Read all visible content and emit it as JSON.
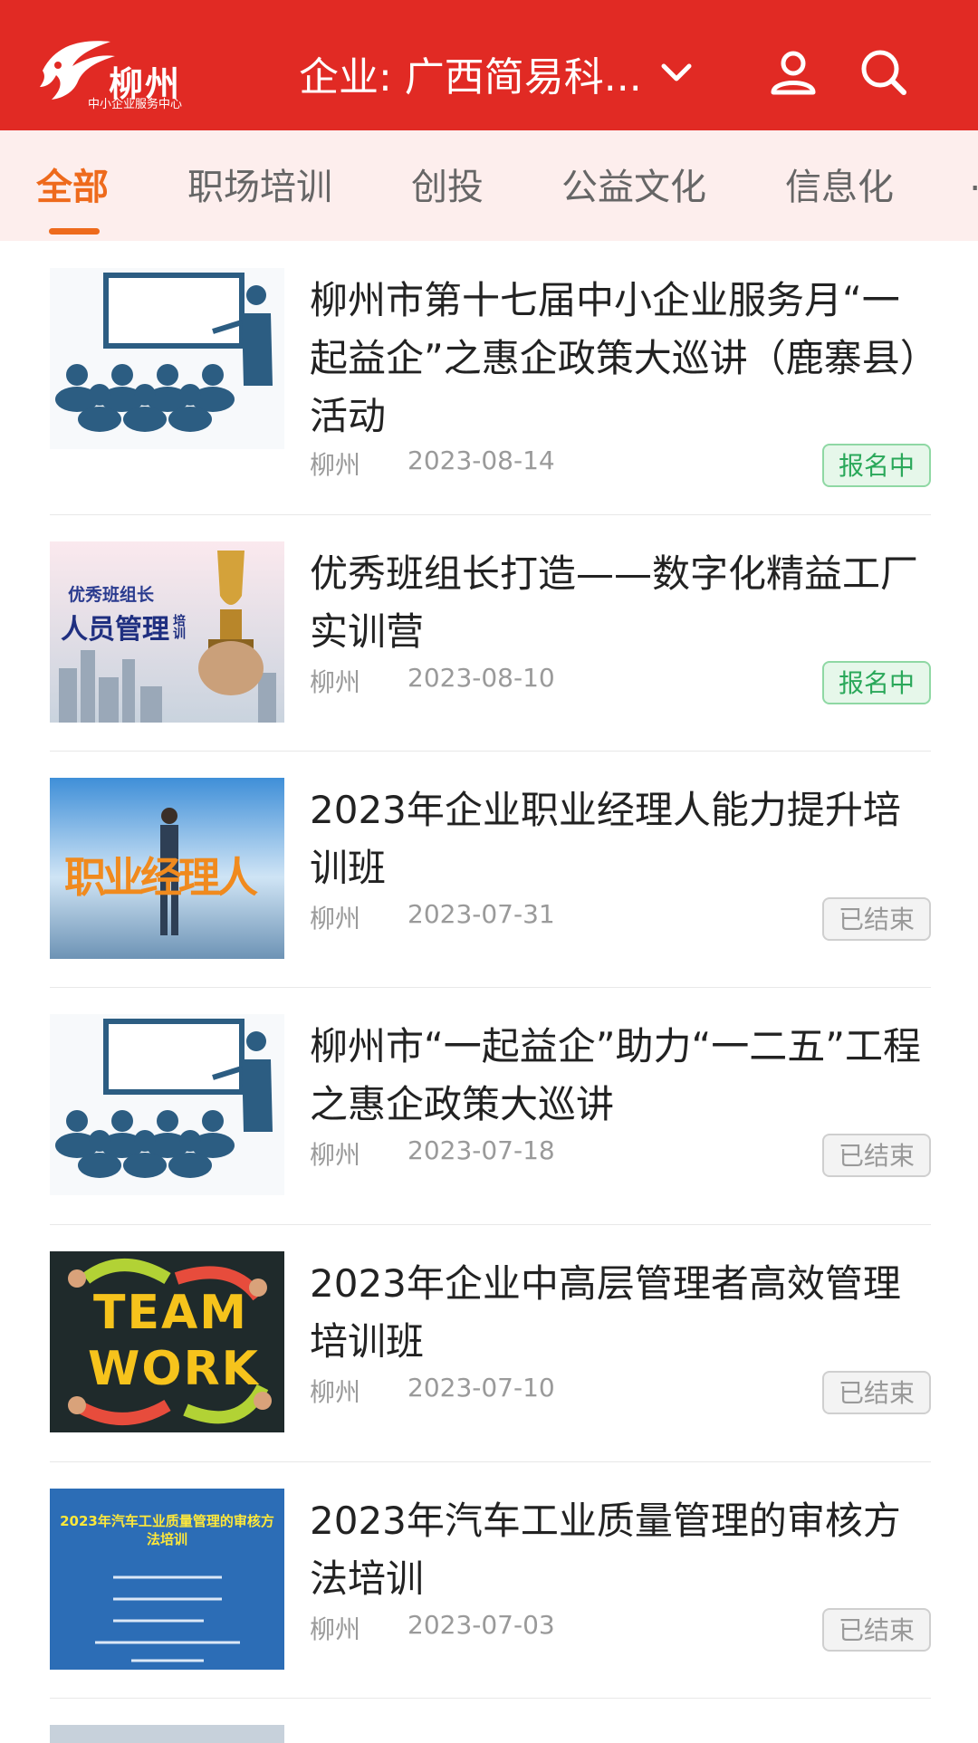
{
  "header": {
    "logo_text": "柳州",
    "logo_sub": "中小企业服务中心",
    "enterprise_label": "企业: 广西简易科...",
    "colors": {
      "header_bg": "#e12a24",
      "accent": "#ee6a1c"
    },
    "icons": {
      "dropdown": "chevron-down-icon",
      "user": "user-icon",
      "search": "search-icon"
    }
  },
  "tabs": [
    {
      "label": "全部",
      "active": true
    },
    {
      "label": "职场培训",
      "active": false
    },
    {
      "label": "创投",
      "active": false
    },
    {
      "label": "公益文化",
      "active": false
    },
    {
      "label": "信息化",
      "active": false
    },
    {
      "label": "…",
      "active": false
    }
  ],
  "items": [
    {
      "title": "柳州市第十七届中小企业服务月“一起益企”之惠企政策大巡讲（鹿寨县）活动",
      "location": "柳州",
      "date": "2023-08-14",
      "status": "报名中",
      "status_kind": "open"
    },
    {
      "title": "优秀班组长打造——数字化精益工厂实训营",
      "location": "柳州",
      "date": "2023-08-10",
      "status": "报名中",
      "status_kind": "open",
      "thumb_text": {
        "line1": "优秀班组长",
        "line2": "人员管理",
        "side": "培训"
      }
    },
    {
      "title": "2023年企业职业经理人能力提升培训班",
      "location": "柳州",
      "date": "2023-07-31",
      "status": "已结束",
      "status_kind": "closed",
      "thumb_text": {
        "line1": "职业经理人"
      }
    },
    {
      "title": "柳州市“一起益企”助力“一二五”工程之惠企政策大巡讲",
      "location": "柳州",
      "date": "2023-07-18",
      "status": "已结束",
      "status_kind": "closed"
    },
    {
      "title": "2023年企业中高层管理者高效管理培训班",
      "location": "柳州",
      "date": "2023-07-10",
      "status": "已结束",
      "status_kind": "closed",
      "thumb_text": {
        "line1": "TEAM",
        "line2": "WORK"
      }
    },
    {
      "title": "2023年汽车工业质量管理的审核方法培训",
      "location": "柳州",
      "date": "2023-07-03",
      "status": "已结束",
      "status_kind": "closed",
      "thumb_text": {
        "line1": "2023年汽车工业质量管理的审核方法培训"
      }
    }
  ]
}
